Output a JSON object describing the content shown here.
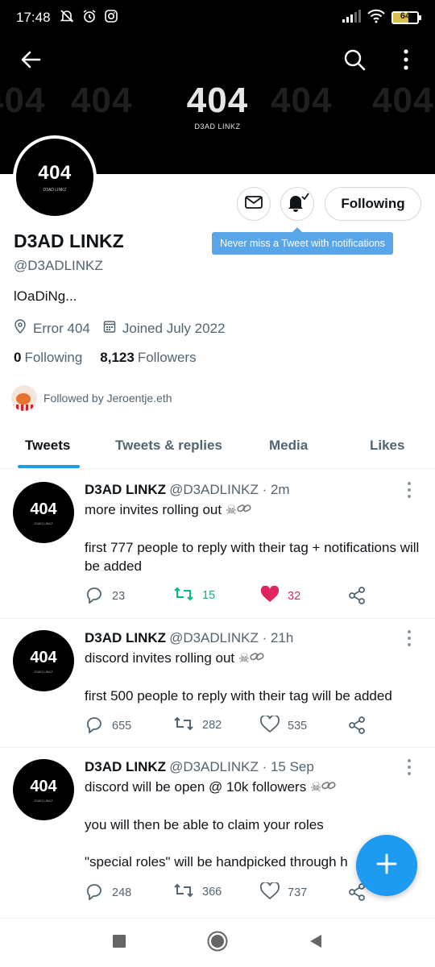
{
  "status_bar": {
    "time": "17:48",
    "battery_level": "64"
  },
  "banner": {
    "title": "404",
    "subtitle": "D3AD LINKZ"
  },
  "avatar": {
    "title": "404",
    "subtitle": "D3AD LINKZ"
  },
  "actions": {
    "following_label": "Following",
    "tooltip": "Never miss a Tweet with notifications"
  },
  "profile": {
    "display_name": "D3AD LINKZ",
    "handle": "@D3ADLINKZ",
    "bio": "lOaDiNg...",
    "location": "Error 404",
    "joined": "Joined July 2022",
    "following_count": "0",
    "following_label": "Following",
    "followers_count": "8,123",
    "followers_label": "Followers",
    "followed_by": "Followed by Jeroentje.eth"
  },
  "tabs": [
    {
      "label": "Tweets"
    },
    {
      "label": "Tweets & replies"
    },
    {
      "label": "Media"
    },
    {
      "label": "Likes"
    }
  ],
  "tweets": [
    {
      "name": "D3AD LINKZ",
      "meta": "@D3ADLINKZ · 2m",
      "line1": "more invites rolling out",
      "line2": "first 777 people to reply with their tag + notifications will be added",
      "line3": "",
      "replies": "23",
      "retweets": "15",
      "likes": "32"
    },
    {
      "name": "D3AD LINKZ",
      "meta": "@D3ADLINKZ · 21h",
      "line1": "discord invites rolling out",
      "line2": "first 500 people to reply with their tag will be added",
      "line3": "",
      "replies": "655",
      "retweets": "282",
      "likes": "535"
    },
    {
      "name": "D3AD LINKZ",
      "meta": "@D3ADLINKZ · 15 Sep",
      "line1": "discord will be open @ 10k followers",
      "line2": "you will then be able to claim your roles",
      "line3": "\"special roles\" will be handpicked through h",
      "replies": "248",
      "retweets": "366",
      "likes": "737"
    }
  ],
  "colors": {
    "accent": "#1d9bf0",
    "retweet_active": "#00ba7c",
    "like_active": "#e0245e",
    "tooltip": "#58a5e8"
  }
}
